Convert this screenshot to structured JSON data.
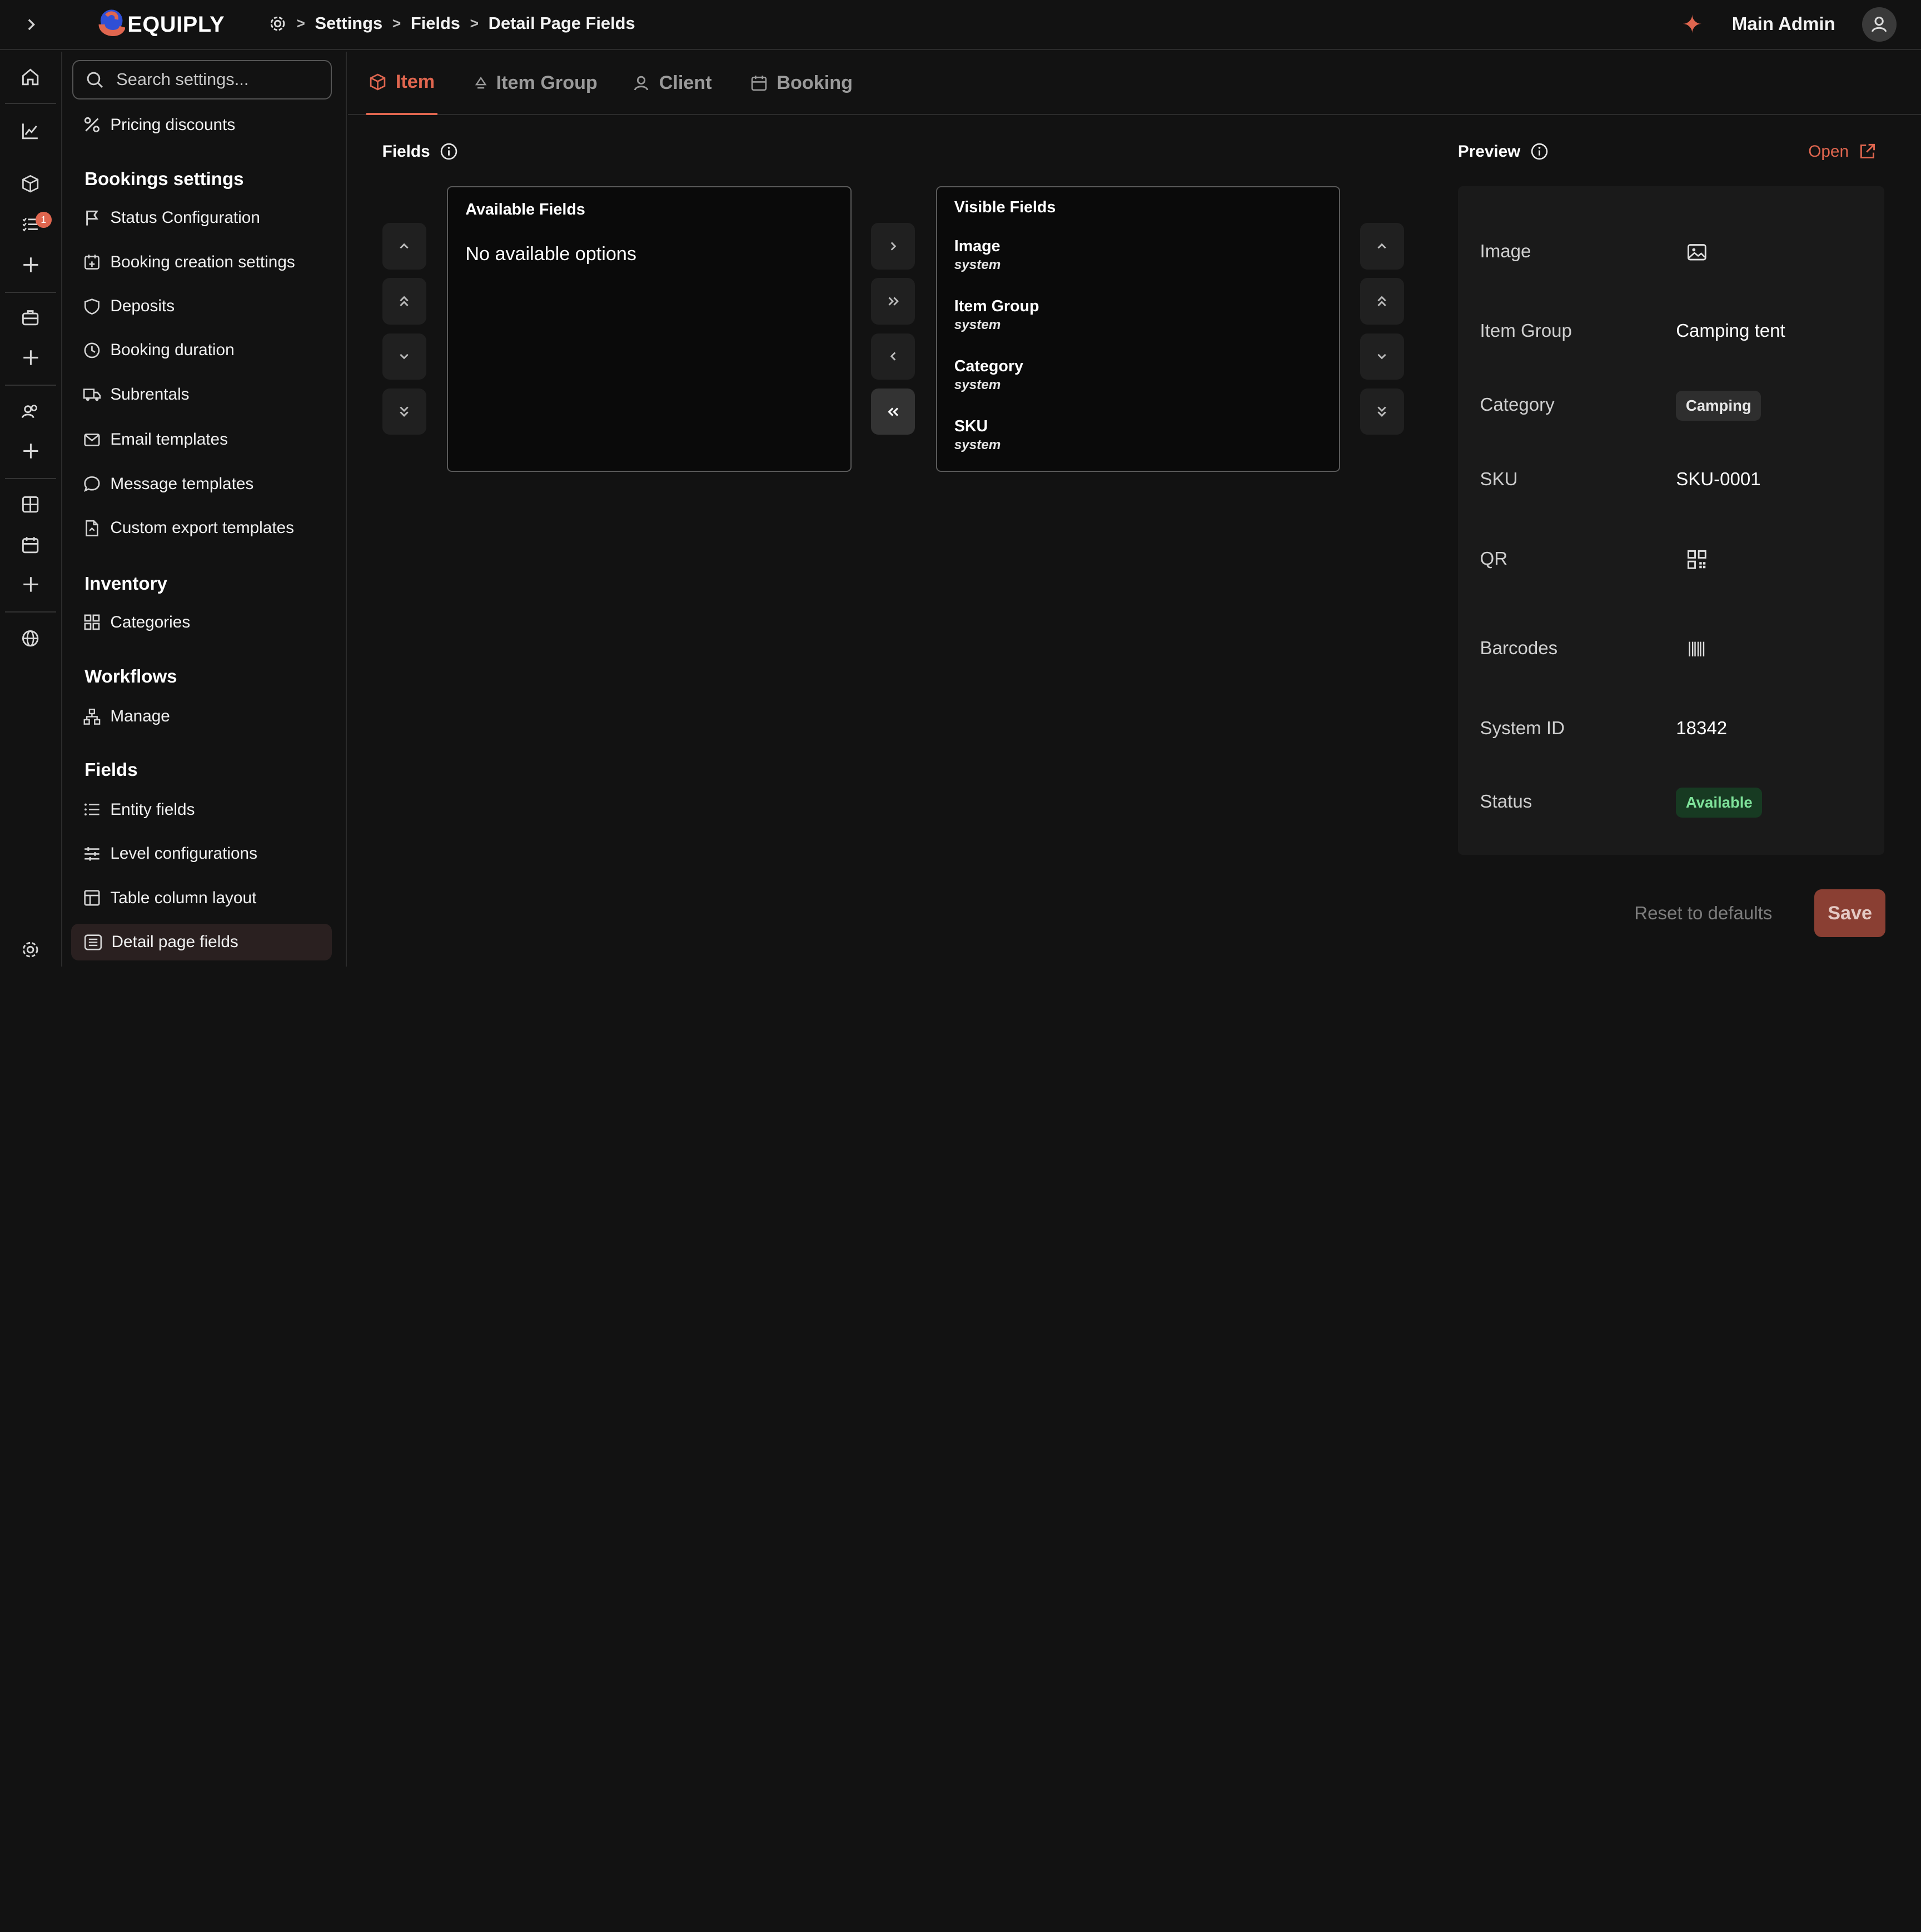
{
  "app": {
    "brand": "EQUIPLY"
  },
  "breadcrumb": {
    "items": [
      "Settings",
      "Fields",
      "Detail Page Fields"
    ]
  },
  "header": {
    "user_name": "Main Admin"
  },
  "rail": {
    "badge_count": "1"
  },
  "sidebar": {
    "search_placeholder": "Search settings...",
    "pricing_discounts": "Pricing discounts",
    "sections": {
      "bookings": "Bookings settings",
      "inventory": "Inventory",
      "workflows": "Workflows",
      "fields": "Fields"
    },
    "bookings_items": [
      "Status Configuration",
      "Booking creation settings",
      "Deposits",
      "Booking duration",
      "Subrentals",
      "Email templates",
      "Message templates",
      "Custom export templates"
    ],
    "inventory_items": [
      "Categories"
    ],
    "workflow_items": [
      "Manage"
    ],
    "fields_items": [
      "Entity fields",
      "Level configurations",
      "Table column layout",
      "Detail page fields"
    ]
  },
  "tabs": [
    "Item",
    "Item Group",
    "Client",
    "Booking"
  ],
  "fields": {
    "label": "Fields",
    "available_title": "Available Fields",
    "empty_text": "No available options",
    "visible_title": "Visible Fields",
    "visible": [
      {
        "name": "Image",
        "type": "system"
      },
      {
        "name": "Item Group",
        "type": "system"
      },
      {
        "name": "Category",
        "type": "system"
      },
      {
        "name": "SKU",
        "type": "system"
      }
    ]
  },
  "preview": {
    "label": "Preview",
    "open_label": "Open",
    "rows": {
      "image": "Image",
      "item_group": "Item Group",
      "item_group_value": "Camping tent",
      "category": "Category",
      "category_value": "Camping",
      "sku": "SKU",
      "sku_value": "SKU-0001",
      "qr": "QR",
      "barcodes": "Barcodes",
      "system_id": "System ID",
      "system_id_value": "18342",
      "status": "Status",
      "status_value": "Available"
    }
  },
  "actions": {
    "reset": "Reset to defaults",
    "save": "Save"
  },
  "colors": {
    "accent": "#e0664f",
    "background": "#121212",
    "status_green": "#7ee29a"
  }
}
